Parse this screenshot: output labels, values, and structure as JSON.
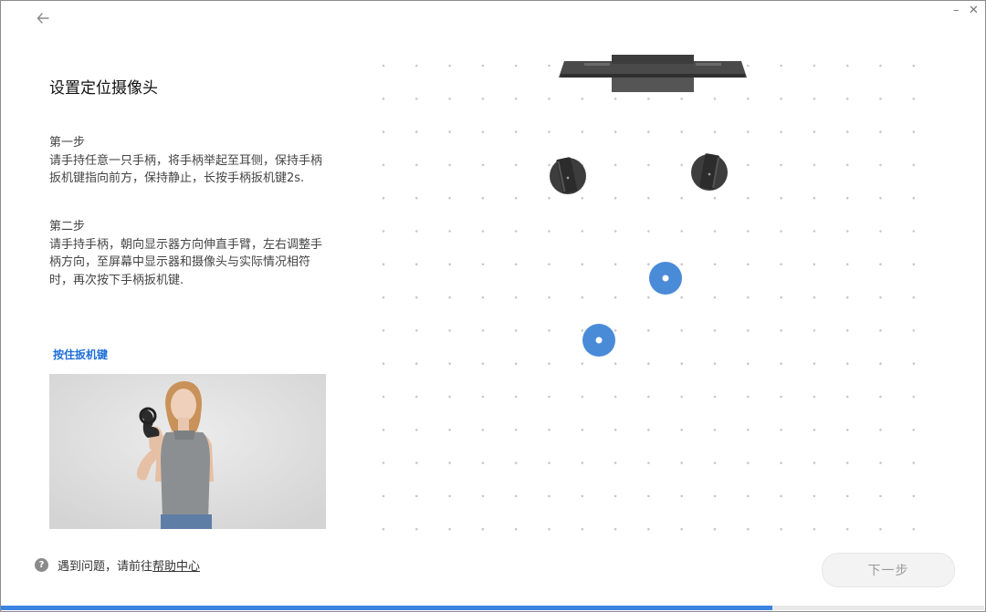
{
  "window": {
    "back_glyph": "←",
    "minimize_glyph": "–",
    "close_glyph": "✕"
  },
  "left": {
    "title": "设置定位摄像头",
    "step1": {
      "heading": "第一步",
      "body": "请手持任意一只手柄，将手柄举起至耳侧，保持手柄扳机键指向前方，保持静止，长按手柄扳机键2s."
    },
    "step2": {
      "heading": "第二步",
      "body": "请手持手柄，朝向显示器方向伸直手臂，左右调整手柄方向，至屏幕中显示器和摄像头与实际情况相符时，再次按下手柄扳机键."
    },
    "hint_label": "按住扳机键"
  },
  "footer": {
    "help_icon": "?",
    "help_prefix": "遇到问题，请前往",
    "help_link": "帮助中心",
    "next_label": "下一步"
  },
  "progress": {
    "fraction": 0.785
  },
  "colors": {
    "accent": "#3a83e0",
    "marker": "#4a8bd8",
    "device": "#3f3f3f"
  }
}
